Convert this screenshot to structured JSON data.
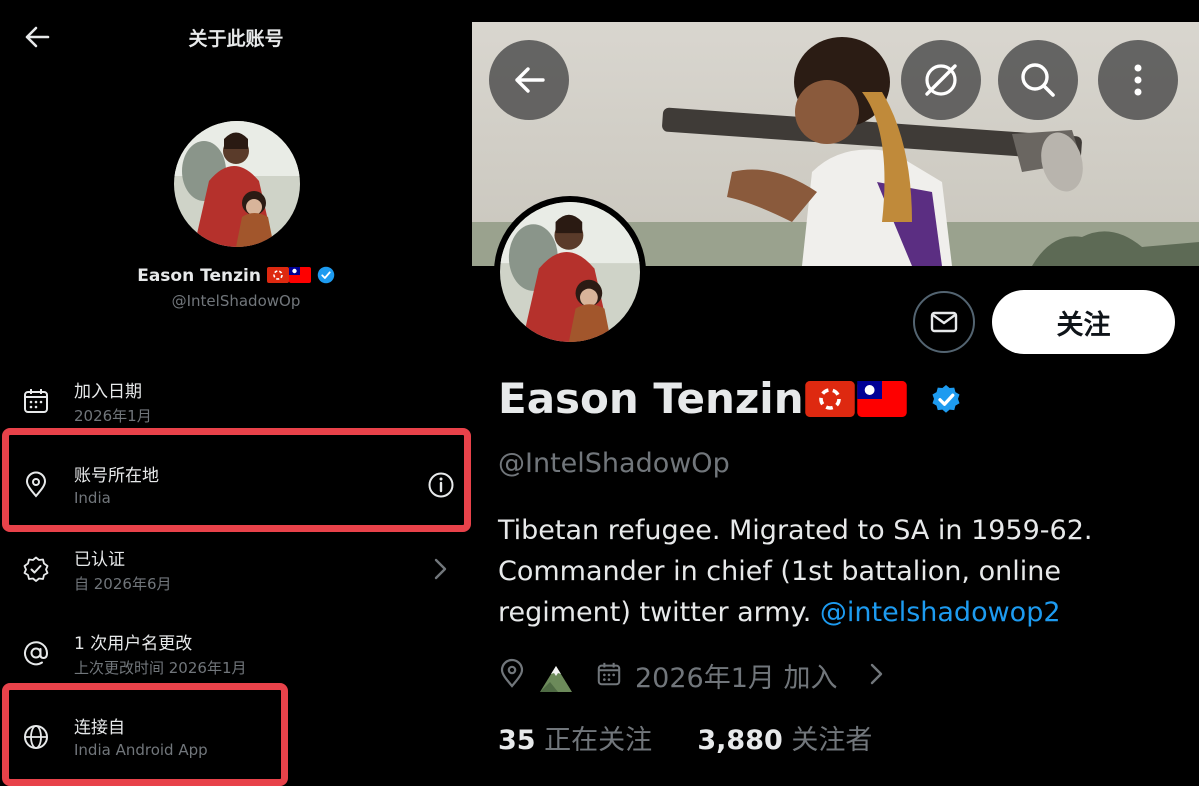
{
  "left_panel": {
    "title": "关于此账号",
    "display_name": "Eason Tenzin",
    "handle": "@IntelShadowOp",
    "rows": [
      {
        "title": "加入日期",
        "subtitle": "2026年1月",
        "icon": "calendar-icon"
      },
      {
        "title": "账号所在地",
        "subtitle": "India",
        "icon": "location-pin-icon"
      },
      {
        "title": "已认证",
        "subtitle": "自 2026年6月",
        "icon": "verified-badge-icon"
      },
      {
        "title": "1 次用户名更改",
        "subtitle": "上次更改时间 2026年1月",
        "icon": "at-sign-icon"
      },
      {
        "title": "连接自",
        "subtitle": "India Android App",
        "icon": "globe-icon"
      }
    ]
  },
  "right_panel": {
    "display_name": "Eason Tenzin",
    "handle": "@IntelShadowOp",
    "follow_label": "关注",
    "bio_text": "Tibetan refugee. Migrated to SA in 1959-62. Commander in chief  (1st battalion, online regiment) twitter army. ",
    "bio_mention": "@intelshadowop2",
    "join_date": "2026年1月 加入",
    "following_count": "35",
    "following_label": "正在关注",
    "followers_count": "3,880",
    "followers_label": "关注者"
  },
  "colors": {
    "background": "#000000",
    "text_primary": "#e7e9ea",
    "text_secondary": "#71767b",
    "accent_blue": "#1d9bf0",
    "highlight_red": "#e8424a"
  }
}
